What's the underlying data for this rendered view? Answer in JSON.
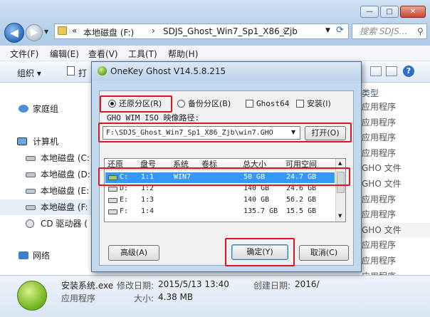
{
  "window": {
    "minimize_label": "—",
    "maximize_label": "□",
    "close_label": "✕"
  },
  "address": {
    "path": [
      "本地磁盘 (F:)",
      "SDJS_Ghost_Win7_Sp1_X86_Zjb"
    ],
    "separator": "›",
    "overflow": "«",
    "search_placeholder": "搜索 SDJS..."
  },
  "menu": [
    "文件(F)",
    "编辑(E)",
    "查看(V)",
    "工具(T)",
    "帮助(H)"
  ],
  "toolbar": {
    "organize_label": "组织 ▾",
    "open_label": "打"
  },
  "navpane": {
    "homegroup": "家庭组",
    "computer": "计算机",
    "drives": [
      "本地磁盘 (C:",
      "本地磁盘 (D:",
      "本地磁盘 (E:",
      "本地磁盘 (F:",
      "CD 驱动器 ("
    ],
    "network": "网络"
  },
  "file_list": {
    "type_header": "类型",
    "types": [
      "应用程序",
      "应用程序",
      "应用程序",
      "应用程序",
      "GHO 文件",
      "GHO 文件",
      "应用程序",
      "应用程序",
      "GHO 文件",
      "应用程序",
      "应用程序",
      "应用程序",
      "应用程序",
      "应用程序"
    ]
  },
  "details": {
    "filename": "安装系统.exe",
    "file_type": "应用程序",
    "modified_label": "修改日期:",
    "modified_value": "2015/5/13 13:40",
    "size_label": "大小:",
    "size_value": "4.38 MB",
    "created_label": "创建日期:",
    "created_value": "2016/"
  },
  "dialog": {
    "title": "OneKey Ghost V14.5.8.215",
    "restore_label": "还原分区(R)",
    "backup_label": "备份分区(B)",
    "ghost64_label": "Ghost64",
    "install_label": "安装(I)",
    "path_label": "GHO WIM ISO 映像路径:",
    "path_value": "F:\\SDJS_Ghost_Win7_Sp1_X86_Zjb\\win7.GHO",
    "open_button": "打开(O)",
    "advanced_button": "高级(A)",
    "ok_button": "确定(Y)",
    "cancel_button": "取消(C)",
    "columns": [
      "还原",
      "盘号",
      "系统",
      "卷标",
      "总大小",
      "可用空间"
    ],
    "rows": [
      {
        "drive": "C:",
        "disk": "1:1",
        "system": "WIN7",
        "label": "",
        "total": "50 GB",
        "free": "24.7 GB",
        "selected": true
      },
      {
        "drive": "D:",
        "disk": "1:2",
        "system": "",
        "label": "",
        "total": "140 GB",
        "free": "24.6 GB",
        "selected": false
      },
      {
        "drive": "E:",
        "disk": "1:3",
        "system": "",
        "label": "",
        "total": "140 GB",
        "free": "56.2 GB",
        "selected": false
      },
      {
        "drive": "F:",
        "disk": "1:4",
        "system": "",
        "label": "",
        "total": "135.7 GB",
        "free": "15.5 GB",
        "selected": false
      }
    ]
  },
  "colors": {
    "highlight_red": "#e0141b",
    "selection_blue": "#3399ff"
  }
}
